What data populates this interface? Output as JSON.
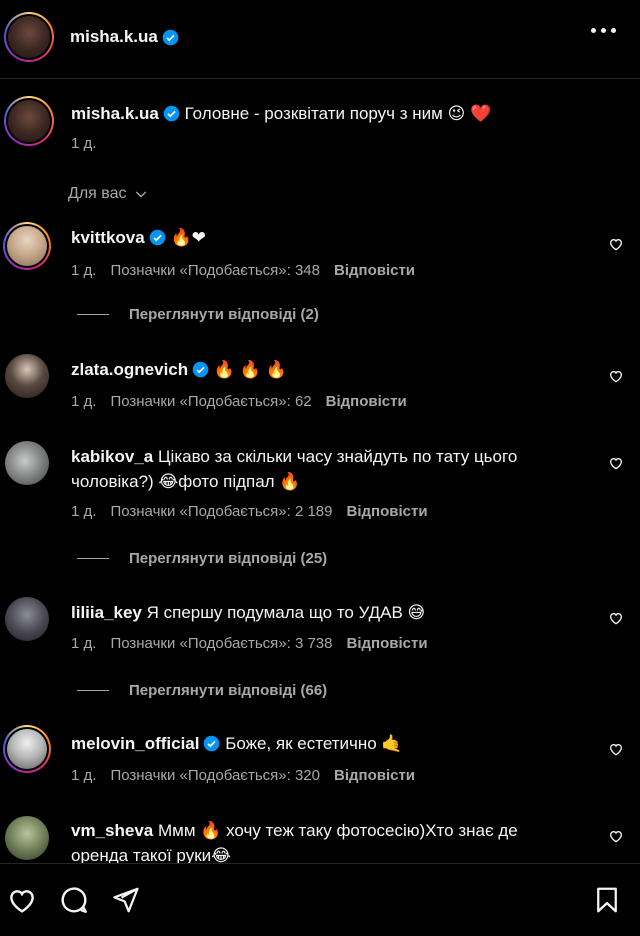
{
  "header": {
    "username": "misha.k.ua"
  },
  "post": {
    "username": "misha.k.ua",
    "caption": "Головне - розквітати поруч з ним",
    "caption_emoji": "😉 ❤️",
    "time": "1 д."
  },
  "filter": {
    "label": "Для вас"
  },
  "comments": [
    {
      "username": "kvittkova",
      "verified": true,
      "text": "",
      "emoji": "🔥❤",
      "time": "1 д.",
      "likes": "Позначки «Подобається»: 348",
      "reply": "Відповісти",
      "view_replies": "Переглянути відповіді (2)"
    },
    {
      "username": "zlata.ognevich",
      "verified": true,
      "text": "",
      "emoji": "🔥 🔥 🔥",
      "time": "1 д.",
      "likes": "Позначки «Подобається»: 62",
      "reply": "Відповісти"
    },
    {
      "username": "kabikov_a",
      "verified": false,
      "text": "Цікаво за скільки часу знайдуть по тату цього чоловіка?) 😂фото підпал 🔥",
      "time": "1 д.",
      "likes": "Позначки «Подобається»: 2 189",
      "reply": "Відповісти",
      "view_replies": "Переглянути відповіді (25)"
    },
    {
      "username": "liliia_key",
      "verified": false,
      "text": "Я спершу подумала що то УДАВ 😅",
      "time": "1 д.",
      "likes": "Позначки «Подобається»: 3 738",
      "reply": "Відповісти",
      "view_replies": "Переглянути відповіді (66)"
    },
    {
      "username": "melovin_official",
      "verified": true,
      "text": "Боже, як естетично 🤙",
      "time": "1 д.",
      "likes": "Позначки «Подобається»: 320",
      "reply": "Відповісти"
    },
    {
      "username": "vm_sheva",
      "verified": false,
      "text": "Ммм 🔥 хочу теж таку фотосесію)Хто знає де оренда такої руки😂"
    }
  ],
  "colors": {
    "background": "#000000",
    "text": "#f5f5f5",
    "muted": "#a8a8a8",
    "verified": "#0095f6",
    "divider": "#262626"
  },
  "icons": [
    "more-icon",
    "verified-icon",
    "heart-icon",
    "comment-icon",
    "share-icon",
    "bookmark-icon",
    "chevron-down-icon"
  ]
}
